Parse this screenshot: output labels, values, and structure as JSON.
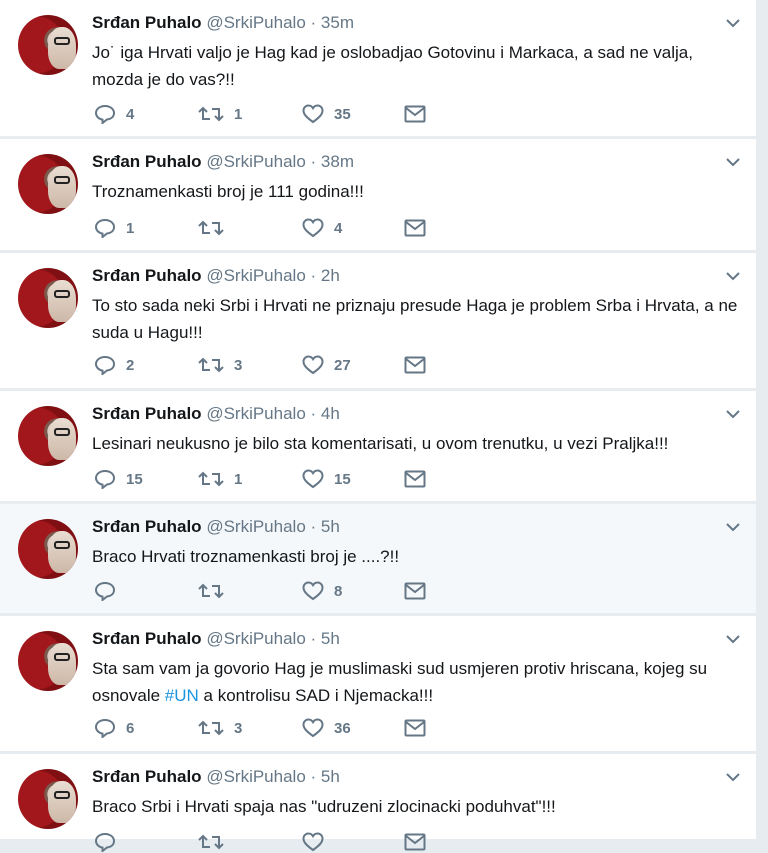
{
  "tweets": [
    {
      "name": "Srđan Puhalo",
      "handle": "@SrkiPuhalo",
      "dot": "·",
      "time": "35m",
      "text": "Jo˙ iga Hrvati valjo je Hag kad je oslobadjao Gotovinu i Markaca, a sad ne valja, mozda je do vas?!!",
      "replies": "4",
      "retweets": "1",
      "likes": "35"
    },
    {
      "name": "Srđan Puhalo",
      "handle": "@SrkiPuhalo",
      "dot": "·",
      "time": "38m",
      "text": "Troznamenkasti broj je 111 godina!!!",
      "replies": "1",
      "retweets": "",
      "likes": "4"
    },
    {
      "name": "Srđan Puhalo",
      "handle": "@SrkiPuhalo",
      "dot": "·",
      "time": "2h",
      "text": "To sto sada neki Srbi i Hrvati ne priznaju presude Haga je problem Srba i Hrvata, a ne suda u Hagu!!!",
      "replies": "2",
      "retweets": "3",
      "likes": "27"
    },
    {
      "name": "Srđan Puhalo",
      "handle": "@SrkiPuhalo",
      "dot": "·",
      "time": "4h",
      "text": "Lesinari neukusno je bilo sta komentarisati, u ovom trenutku, u vezi Praljka!!!",
      "replies": "15",
      "retweets": "1",
      "likes": "15"
    },
    {
      "name": "Srđan Puhalo",
      "handle": "@SrkiPuhalo",
      "dot": "·",
      "time": "5h",
      "text": "Braco Hrvati troznamenkasti broj je ....?!!",
      "replies": "",
      "retweets": "",
      "likes": "8"
    },
    {
      "name": "Srđan Puhalo",
      "handle": "@SrkiPuhalo",
      "dot": "·",
      "time": "5h",
      "text_before": "Sta sam vam ja govorio Hag je muslimaski sud usmjeren protiv hriscana, kojeg su osnovale ",
      "hashtag": "#UN",
      "text_after": " a kontrolisu SAD i Njemacka!!!",
      "replies": "6",
      "retweets": "3",
      "likes": "36"
    },
    {
      "name": "Srđan Puhalo",
      "handle": "@SrkiPuhalo",
      "dot": "·",
      "time": "5h",
      "text": "Braco Srbi i Hrvati spaja nas \"udruzeni zlocinacki poduhvat\"!!!",
      "replies": "",
      "retweets": "",
      "likes": ""
    }
  ],
  "icons": {
    "reply": "reply-icon",
    "retweet": "retweet-icon",
    "like": "heart-icon",
    "dm": "envelope-icon",
    "menu": "chevron-down-icon"
  },
  "colors": {
    "link": "#1b95e0",
    "muted": "#657786",
    "background": "#e6ecf0"
  }
}
